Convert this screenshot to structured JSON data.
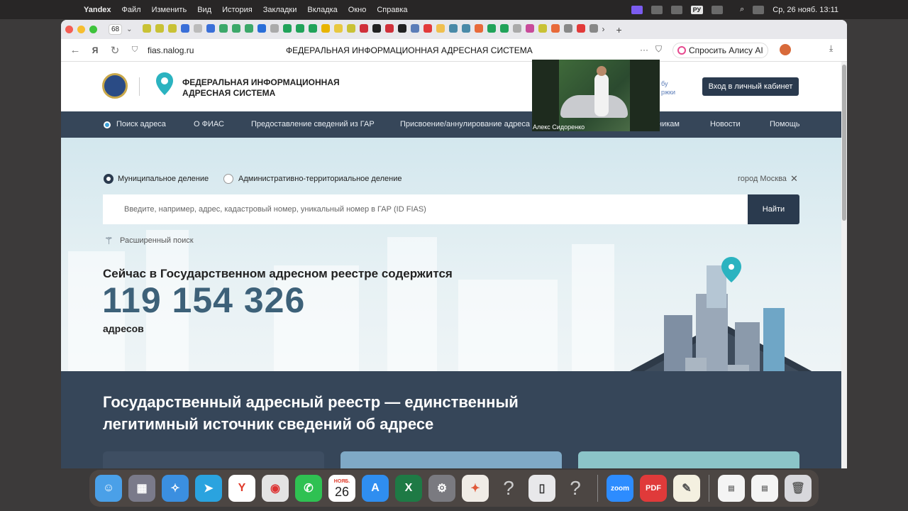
{
  "menubar": {
    "app_name": "Yandex",
    "items": [
      "Файл",
      "Изменить",
      "Вид",
      "История",
      "Закладки",
      "Вкладка",
      "Окно",
      "Справка"
    ],
    "lang": "РУ",
    "clock": "Ср, 26 нояб.  13:11"
  },
  "browser": {
    "tab_count": "68",
    "url": "fias.nalog.ru",
    "page_title": "ФЕДЕРАЛЬНАЯ ИНФОРМАЦИОННАЯ АДРЕСНАЯ СИСТЕМА",
    "alice_button": "Спросить Алису AI"
  },
  "site": {
    "title_line1": "ФЕДЕРАЛЬНАЯ ИНФОРМАЦИОННАЯ",
    "title_line2": "АДРЕСНАЯ СИСТЕМА",
    "support_line1": "бу",
    "support_line2": "ржки",
    "login_button": "Вход в личный кабинет"
  },
  "nav": {
    "items": [
      "Поиск адреса",
      "О ФИАС",
      "Предоставление сведений из ГАР",
      "Присвоение/аннулирование адреса",
      "никам",
      "Новости",
      "Помощь"
    ]
  },
  "search": {
    "radio_municipal": "Муниципальное деление",
    "radio_admin": "Административно-территориальное деление",
    "city": "город Москва",
    "placeholder": "Введите, например, адрес, кадастровый номер, уникальный номер в ГАР (ID FIAS)",
    "button": "Найти",
    "advanced": "Расширенный поиск"
  },
  "stats": {
    "heading": "Сейчас в Государственном адресном реестре содержится",
    "number": "119 154 326",
    "unit": "адресов"
  },
  "band": {
    "title": "Государственный адресный реестр — единственный легитимный источник сведений об адресе"
  },
  "video": {
    "participant": "Алекс Сидоренко"
  },
  "dock": {
    "calendar_month": "НОЯБ.",
    "calendar_day": "26",
    "zoom_label": "zoom"
  }
}
